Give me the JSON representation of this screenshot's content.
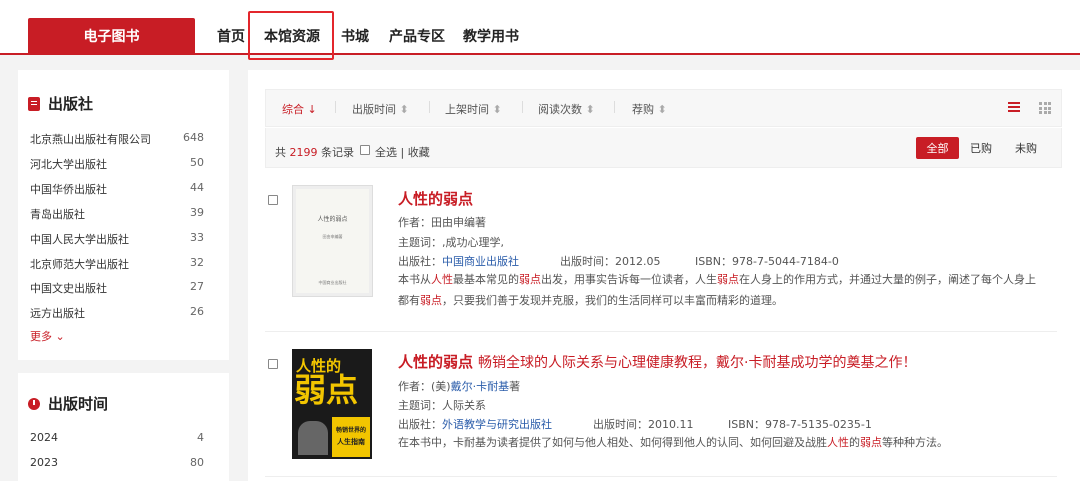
{
  "header": {
    "brand": "电子图书",
    "nav": [
      "首页",
      "本馆资源",
      "书城",
      "产品专区",
      "教学用书"
    ]
  },
  "publisher_panel": {
    "title": "出版社",
    "items": [
      {
        "name": "北京燕山出版社有限公司",
        "count": "648"
      },
      {
        "name": "河北大学出版社",
        "count": "50"
      },
      {
        "name": "中国华侨出版社",
        "count": "44"
      },
      {
        "name": "青岛出版社",
        "count": "39"
      },
      {
        "name": "中国人民大学出版社",
        "count": "33"
      },
      {
        "name": "北京师范大学出版社",
        "count": "32"
      },
      {
        "name": "中国文史出版社",
        "count": "27"
      },
      {
        "name": "远方出版社",
        "count": "26"
      }
    ],
    "more": "更多"
  },
  "time_panel": {
    "title": "出版时间",
    "items": [
      {
        "name": "2024",
        "count": "4"
      },
      {
        "name": "2023",
        "count": "80"
      }
    ]
  },
  "sort": {
    "items": [
      "综合",
      "出版时间",
      "上架时间",
      "阅读次数",
      "荐购"
    ],
    "active_arrow": "↓",
    "arrow": "⬍"
  },
  "summary": {
    "prefix": "共",
    "count": "2199",
    "suffix": "条记录",
    "select_all": "全选",
    "sep": "|",
    "favorite": "收藏",
    "filters": [
      "全部",
      "已购",
      "未购"
    ]
  },
  "books": [
    {
      "title": "人性的弱点",
      "subtitle": "",
      "author_label": "作者：",
      "author": "田由申编著",
      "subject_label": "主题词：",
      "subject": ",成功心理学,",
      "publisher_label": "出版社：",
      "publisher": "中国商业出版社",
      "date_label": "出版时间：",
      "date": "2012.05",
      "isbn_label": "ISBN：",
      "isbn": "978-7-5044-7184-0",
      "cover_title": "人性的弱点",
      "cover_author": "田由申编著",
      "cover_publisher": "中国商业出版社"
    },
    {
      "title": "人性的弱点",
      "subtitle": "畅销全球的人际关系与心理健康教程，戴尔·卡耐基成功学的奠基之作！",
      "author_label": "作者：",
      "author_prefix": "(美)",
      "author": "戴尔·卡耐基",
      "author_suffix": "著",
      "subject_label": "主题词：",
      "subject": "人际关系",
      "publisher_label": "出版社：",
      "publisher": "外语教学与研究出版社",
      "date_label": "出版时间：",
      "date": "2010.11",
      "isbn_label": "ISBN：",
      "isbn": "978-7-5135-0235-1",
      "cover_line1": "人性的",
      "cover_line2": "弱点",
      "cover_line3": "畅销世界的",
      "cover_line4": "人生指南"
    }
  ],
  "desc1": {
    "p1": "本书从",
    "h1": "人性",
    "p2": "最基本常见的",
    "h2": "弱点",
    "p3": "出发，用事实告诉每一位读者，人生",
    "h3": "弱点",
    "p4": "在人身上的作用方式，并通过大量的例子，阐述了每个人身上都有",
    "h4": "弱点",
    "p5": "，只要我们善于发现并克服，我们的生活同样可以丰富而精彩的道理。"
  },
  "desc2": {
    "p1": "在本书中，卡耐基为读者提供了如何与他人相处、如何得到他人的认同、如何回避及战胜",
    "h1": "人性",
    "p2": "的",
    "h2": "弱点",
    "p3": "等种种方法。"
  },
  "colors": {
    "accent": "#c81d25",
    "link": "#2a5caa"
  }
}
